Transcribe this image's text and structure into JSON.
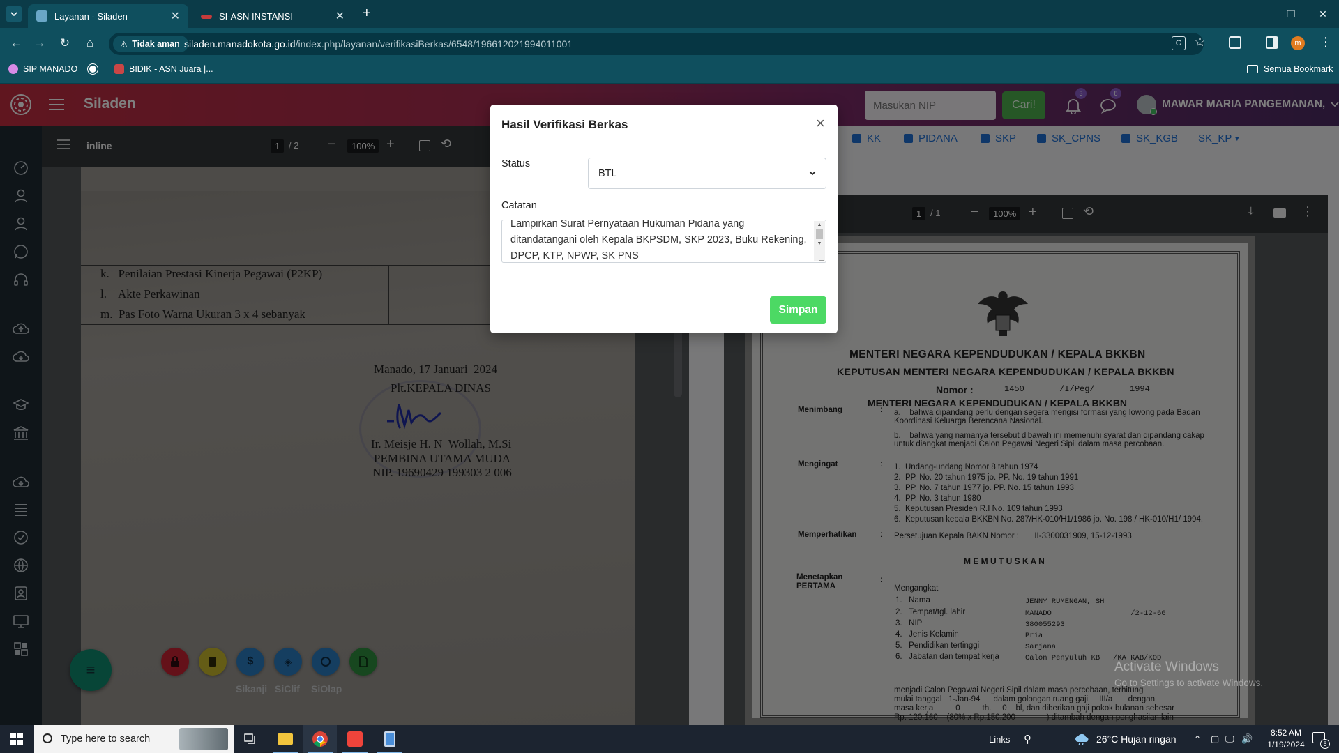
{
  "browser": {
    "tabs": [
      {
        "title": "Layanan - Siladen",
        "active": true
      },
      {
        "title": "SI-ASN INSTANSI",
        "active": false
      }
    ],
    "security_label": "Tidak aman",
    "url_host": "siladen.manadokota.go.id",
    "url_path": "/index.php/layanan/verifikasiBerkas/6548/196612021994011001",
    "bookmarks": [
      "SIP MANADO",
      "BIDIK - ASN Juara |...",
      "Semua Bookmark"
    ]
  },
  "app": {
    "brand": "Siladen",
    "search_placeholder": "Masukan NIP",
    "search_button": "Cari!",
    "notif_count": "3",
    "msg_count": "8",
    "user_name": "MAWAR MARIA PANGEMANAN,"
  },
  "doc_tabs": [
    "KK",
    "PIDANA",
    "SKP",
    "SK_CPNS",
    "SK_KGB",
    "SK_KP"
  ],
  "left_viewer": {
    "title": "inline",
    "page": "1",
    "pages": "/  2",
    "zoom": "100%",
    "doc_lines": [
      "k.   Penilaian Prestasi Kinerja Pegawai (P2KP)",
      "l.    Akte Perkawinan",
      "m.  Pas Foto Warna Ukuran 3 x 4 sebanyak"
    ],
    "sign_place_date": "Manado, 17 Januari  2024",
    "sign_role": "Plt.KEPALA DINAS",
    "sign_name": "Ir. Meisje H. N  Wollah, M.Si",
    "sign_rank": "PEMBINA UTAMA MUDA",
    "sign_nip": "NIP. 19690429 199303 2 006"
  },
  "right_viewer": {
    "page": "1",
    "pages": "/  1",
    "zoom": "100%",
    "header1": "MENTERI NEGARA KEPENDUDUKAN / KEPALA BKKBN",
    "header2": "KEPUTUSAN MENTERI NEGARA KEPENDUDUKAN / KEPALA BKKBN",
    "nomor_label": "Nomor  :",
    "nomor_value": "1450       /I/Peg/       1994",
    "header3": "MENTERI NEGARA KEPENDUDUKAN / KEPALA BKKBN",
    "menimbang_label": "Menimbang",
    "menimbang_items": [
      "a.    bahwa dipandang perlu dengan segera mengisi formasi yang lowong pada Badan Koordinasi Keluarga Berencana Nasional.",
      "b.    bahwa yang namanya tersebut dibawah ini memenuhi syarat dan dipandang cakap untuk diangkat menjadi Calon Pegawai Negeri Sipil dalam masa percobaan."
    ],
    "mengingat_label": "Mengingat",
    "mengingat_items": [
      "1.  Undang-undang Nomor 8 tahun 1974",
      "2.  PP. No. 20 tahun 1975 jo. PP. No. 19 tahun 1991",
      "3.  PP. No. 7 tahun 1977 jo. PP. No. 15 tahun 1993",
      "4.  PP. No. 3 tahun 1980",
      "5.  Keputusan Presiden R.I No. 109 tahun 1993",
      "6.  Keputusan kepala BKKBN No. 287/HK-010/H1/1986 jo. No. 198 / HK-010/H1/ 1994."
    ],
    "memperhatikan_label": "Memperhatikan",
    "memperhatikan_value": "Persetujuan Kepala BAKN Nomor :       II-3300031909, 15-12-1993",
    "memutuskan": "M E M U T U S K A N",
    "menetapkan_label": "Menetapkan",
    "pertama_label": "PERTAMA",
    "mengangkat": "Mengangkat",
    "fields": [
      {
        "k": "1.   Nama",
        "v": "JENNY RUMENGAN, SH"
      },
      {
        "k": "2.   Tempat/tgl. lahir",
        "v": "MANADO                  /2-12-66"
      },
      {
        "k": "3.   NIP",
        "v": "380055293"
      },
      {
        "k": "4.   Jenis Kelamin",
        "v": "Pria"
      },
      {
        "k": "5.   Pendidikan tertinggi",
        "v": "Sarjana"
      },
      {
        "k": "6.   Jabatan dan tempat kerja",
        "v": "Calon Penyuluh KB   /KA KAB/KOD"
      }
    ],
    "closing": [
      "menjadi Calon Pegawai Negeri Sipil dalam masa percobaan, terhitung",
      "mulai tanggal   1-Jan-94      dalam golongan ruang gaji     III/a       dengan",
      "masa kerja          0          th.     0    bl, dan diberikan gaji pokok bulanan sebesar",
      "Rp. 120.160    (80% x Rp.150.200              ) ditambah dengan penghasilan lain"
    ]
  },
  "modal": {
    "title": "Hasil Verifikasi Berkas",
    "close": "×",
    "status_label": "Status",
    "status_value": "BTL",
    "catatan_label": "Catatan",
    "catatan_value": "Lampirkan Surat Pernyataan Hukuman Pidana yang ditandatangani oleh Kepala BKPSDM, SKP 2023, Buku Rekening, DPCP, KTP, NPWP, SK PNS",
    "submit": "Simpan"
  },
  "fab_labels": [
    "Sikanji",
    "SiClif",
    "SiOlap"
  ],
  "watermark": {
    "line1": "Activate Windows",
    "line2": "Go to Settings to activate Windows."
  },
  "taskbar": {
    "search_placeholder": "Type here to search",
    "links": "Links",
    "weather": "26°C  Hujan ringan",
    "time": "8:52 AM",
    "date": "1/19/2024",
    "notif": "5"
  }
}
